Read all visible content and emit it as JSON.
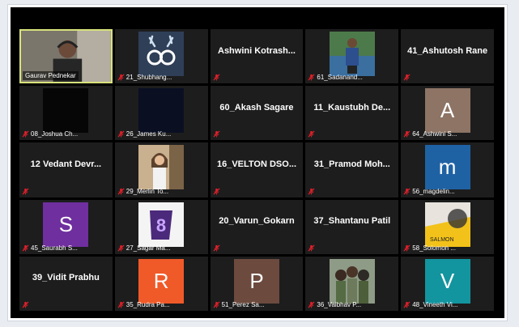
{
  "colors": {
    "active_border": "#d8e27a",
    "muted_icon": "#e0202a",
    "tile_bg": "#1d1d1d"
  },
  "participants": [
    {
      "label": "Gaurav Pednekar",
      "muted": false,
      "type": "video"
    },
    {
      "label": "21_Shubhang...",
      "muted": true,
      "type": "picture",
      "pic": "deer"
    },
    {
      "title": "Ashwini Kotrash...",
      "muted": true,
      "type": "name"
    },
    {
      "label": "61_Sadanand...",
      "muted": true,
      "type": "picture",
      "pic": "person"
    },
    {
      "title": "41_Ashutosh Rane",
      "muted": true,
      "type": "name"
    },
    {
      "label": "08_Joshua Ch...",
      "muted": true,
      "type": "picture",
      "pic": "dark"
    },
    {
      "label": "26_James Ku...",
      "muted": true,
      "type": "picture",
      "pic": "navy"
    },
    {
      "title": "60_Akash Sagare",
      "muted": true,
      "type": "name"
    },
    {
      "title": "11_Kaustubh De...",
      "muted": true,
      "type": "name"
    },
    {
      "label": "64_Ashwini S...",
      "muted": true,
      "type": "letter",
      "letter": "A",
      "color": "#8d7465"
    },
    {
      "title": "12 Vedant Devr...",
      "muted": true,
      "type": "name"
    },
    {
      "label": "29_Merlin To...",
      "muted": true,
      "type": "picture",
      "pic": "girl"
    },
    {
      "title": "16_VELTON DSO...",
      "muted": true,
      "type": "name"
    },
    {
      "title": "31_Pramod Moh...",
      "muted": true,
      "type": "name"
    },
    {
      "label": "56_magdelin...",
      "muted": true,
      "type": "letter",
      "letter": "m",
      "color": "#1f62a4"
    },
    {
      "label": "45_Saurabh S...",
      "muted": true,
      "type": "letter",
      "letter": "S",
      "color": "#6f2f9e"
    },
    {
      "label": "27_Sagar Ma...",
      "muted": true,
      "type": "picture",
      "pic": "purple"
    },
    {
      "title": "20_Varun_Gokarn",
      "muted": true,
      "type": "name"
    },
    {
      "title": "37_Shantanu Patil",
      "muted": true,
      "type": "name"
    },
    {
      "label": "58_Solomon ...",
      "muted": true,
      "type": "picture",
      "pic": "salmon",
      "pic_text": "SALMON"
    },
    {
      "title": "39_Vidit Prabhu",
      "muted": true,
      "type": "name"
    },
    {
      "label": "35_Rudra Pa...",
      "muted": true,
      "type": "letter",
      "letter": "R",
      "color": "#f05a28"
    },
    {
      "label": "51_Perez Sa...",
      "muted": true,
      "type": "letter",
      "letter": "P",
      "color": "#6c4a3e"
    },
    {
      "label": "36_Vaibhav P...",
      "muted": true,
      "type": "picture",
      "pic": "anime"
    },
    {
      "label": "48_Vineeth Vi...",
      "muted": true,
      "type": "letter",
      "letter": "V",
      "color": "#13959f"
    }
  ]
}
